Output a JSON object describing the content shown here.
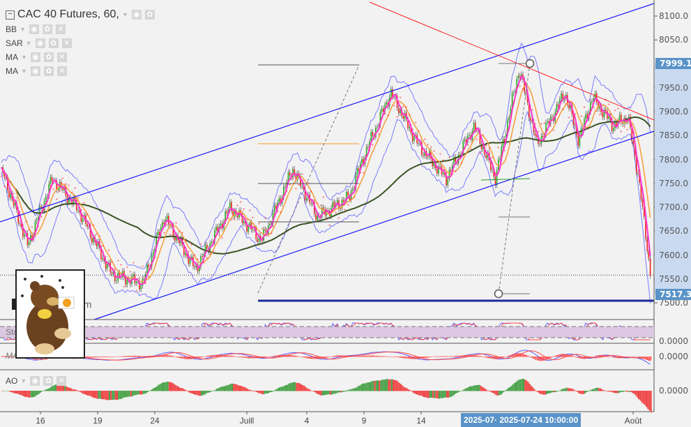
{
  "header": {
    "symbol_title": "CAC 40 Futures, 60,",
    "indicators": [
      {
        "label": "BB"
      },
      {
        "label": "SAR"
      },
      {
        "label": "MA"
      },
      {
        "label": "MA"
      }
    ],
    "sub_panels": [
      {
        "label": "Sto"
      },
      {
        "label": "MA"
      },
      {
        "label": "AO"
      }
    ],
    "watermark_partial": "om"
  },
  "price_axis": {
    "ticks": [
      "8100.0",
      "8050.0",
      "7999.1",
      "7950.0",
      "7900.0",
      "7850.0",
      "7800.0",
      "7750.0",
      "7700.0",
      "7650.0",
      "7600.0",
      "7550.0",
      "7500.0"
    ],
    "tick_values": [
      8100,
      8050,
      null,
      7950,
      7900,
      7850,
      7800,
      7750,
      7700,
      7650,
      7600,
      7550,
      7500
    ],
    "crosshair_price": "7999.1",
    "last_price": "7517.3",
    "oscillator_zero_labels": [
      "0.0000",
      "0.0000",
      "0.0000"
    ]
  },
  "time_axis": {
    "labels": [
      {
        "text": "16",
        "date": "2025-06-16"
      },
      {
        "text": "19",
        "date": "2025-06-19"
      },
      {
        "text": "24",
        "date": "2025-06-24"
      },
      {
        "text": "Juill",
        "date": "2025-07-01"
      },
      {
        "text": "4",
        "date": "2025-07-04"
      },
      {
        "text": "9",
        "date": "2025-07-09"
      },
      {
        "text": "14",
        "date": "2025-07-14"
      },
      {
        "text": "Août",
        "date": "2025-08-01"
      }
    ],
    "crosshair_label": "2025-07· 2025-07-24 10:00:00"
  },
  "colors": {
    "channel": "#1a1aff",
    "resistance": "#ff2020",
    "support_line": "#1c2a9a",
    "ma_long": "#3b5323",
    "ma_short": "#f5a142",
    "ma_fast": "#ff33cc",
    "bollinger": "#7b7bff",
    "sar": "#ff3333",
    "up": "#22aa22",
    "down": "#ee2222",
    "axis_tag": "#5a93c8",
    "stoch_band": "#dcc8e2"
  },
  "chart_data": {
    "type": "candlestick",
    "title": "CAC 40 Futures, 60,",
    "ylim": [
      7480,
      8120
    ],
    "close_path": [
      {
        "t": "2025-06-14 01:00",
        "p": 7770
      },
      {
        "t": "2025-06-15 08:00",
        "p": 7620
      },
      {
        "t": "2025-06-16 15:00",
        "p": 7760
      },
      {
        "t": "2025-06-17 22:00",
        "p": 7700
      },
      {
        "t": "2025-06-20 05:00",
        "p": 7560
      },
      {
        "t": "2025-06-22 23:00",
        "p": 7540
      },
      {
        "t": "2025-06-24 17:00",
        "p": 7680
      },
      {
        "t": "2025-06-27 02:00",
        "p": 7570
      },
      {
        "t": "2025-06-29 18:00",
        "p": 7700
      },
      {
        "t": "2025-07-01 18:00",
        "p": 7630
      },
      {
        "t": "2025-07-03 07:00",
        "p": 7780
      },
      {
        "t": "2025-07-04 22:00",
        "p": 7680
      },
      {
        "t": "2025-07-07 16:00",
        "p": 7720
      },
      {
        "t": "2025-07-08 21:00",
        "p": 7800
      },
      {
        "t": "2025-07-11 08:00",
        "p": 7940
      },
      {
        "t": "2025-07-13 18:00",
        "p": 7830
      },
      {
        "t": "2025-07-16 03:00",
        "p": 7760
      },
      {
        "t": "2025-07-18 12:00",
        "p": 7870
      },
      {
        "t": "2025-07-20 07:00",
        "p": 7760
      },
      {
        "t": "2025-07-22 08:00",
        "p": 7990
      },
      {
        "t": "2025-07-23 20:00",
        "p": 7830
      },
      {
        "t": "2025-07-26 05:00",
        "p": 7940
      },
      {
        "t": "2025-07-27 09:00",
        "p": 7840
      },
      {
        "t": "2025-07-28 13:00",
        "p": 7930
      },
      {
        "t": "2025-07-30 08:00",
        "p": 7870
      },
      {
        "t": "2025-07-31 13:00",
        "p": 7890
      },
      {
        "t": "2025-08-01 10:00",
        "p": 7770
      },
      {
        "t": "2025-08-02 14:00",
        "p": 7540
      }
    ],
    "support_level": 7505,
    "dotted_level": 7558
  }
}
